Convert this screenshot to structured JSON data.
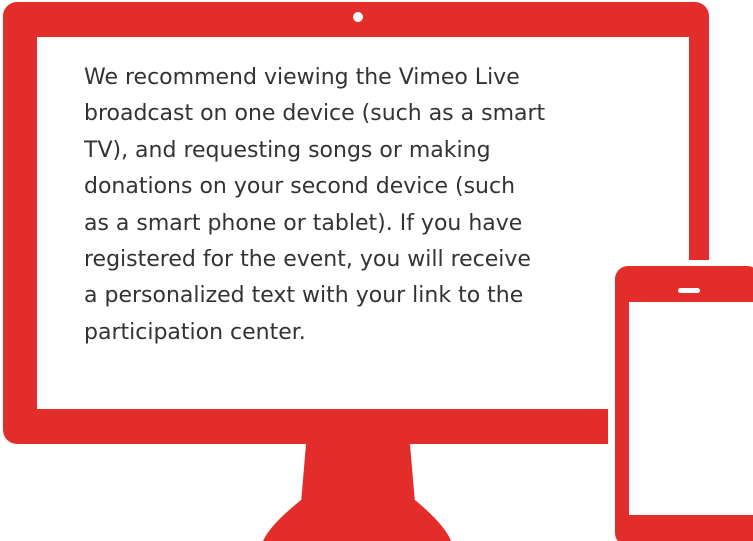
{
  "message": {
    "text": "We recommend viewing the Vimeo Live\nbroadcast on one device (such as a smart\nTV), and requesting songs or making\ndonations on your second device (such\nas a smart phone or tablet). If you have\nregistered for the event, you will receive\na personalized text with your link to the\nparticipation center."
  },
  "colors": {
    "device_red": "#e32d2a",
    "screen_white": "#ffffff",
    "text": "#333333"
  },
  "icons": {
    "monitor": "desktop-monitor-icon",
    "phone": "smartphone-icon"
  }
}
